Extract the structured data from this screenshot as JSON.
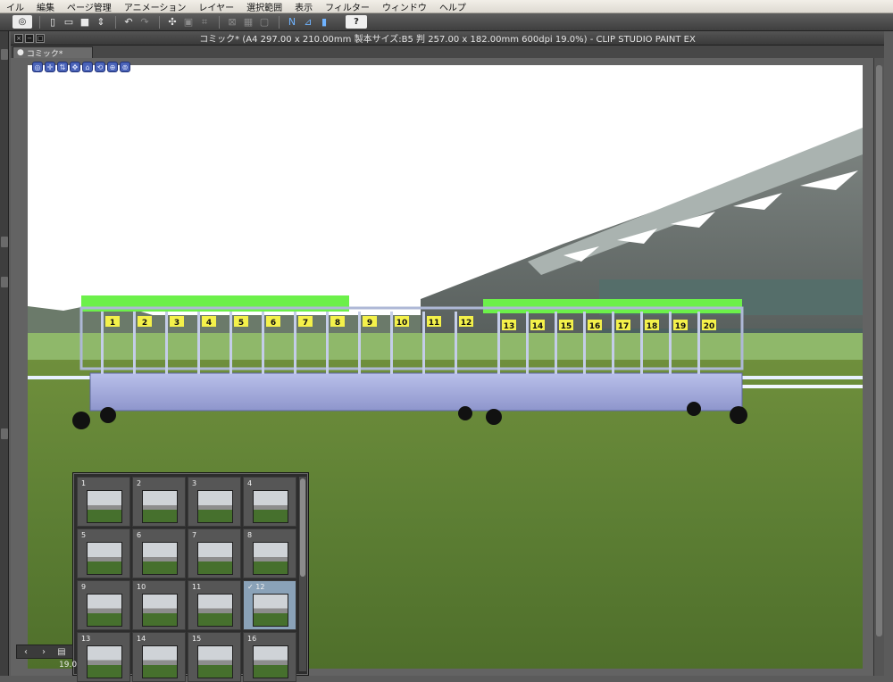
{
  "menubar": {
    "items": [
      "イル",
      "編集",
      "ページ管理",
      "アニメーション",
      "レイヤー",
      "選択範囲",
      "表示",
      "フィルター",
      "ウィンドウ",
      "ヘルプ"
    ]
  },
  "toolbar": {
    "icons": [
      "clip-logo-icon",
      "new-file-icon",
      "open-file-icon",
      "save-icon",
      "sort-icon",
      "undo-icon",
      "redo-icon",
      "transform-icon",
      "fit-icon",
      "crop-icon",
      "clear-icon",
      "fill-icon",
      "delete-icon",
      "snap-ruler-icon",
      "snap-grid-icon",
      "snap-point-icon",
      "help-icon"
    ],
    "help_label": "?"
  },
  "window": {
    "title": "コミック* (A4 297.00 x 210.00mm 製本サイズ:B5 判 257.00 x 182.00mm 600dpi 19.0%)  - CLIP STUDIO PAINT EX",
    "tab": "コミック*"
  },
  "gates": {
    "left": [
      "1",
      "2",
      "3",
      "4",
      "5",
      "6",
      "7",
      "8",
      "9",
      "10",
      "11",
      "12"
    ],
    "right": [
      "13",
      "14",
      "15",
      "16",
      "17",
      "18",
      "19",
      "20"
    ]
  },
  "pages": [
    {
      "num": "1"
    },
    {
      "num": "2"
    },
    {
      "num": "3"
    },
    {
      "num": "4"
    },
    {
      "num": "5"
    },
    {
      "num": "6"
    },
    {
      "num": "7"
    },
    {
      "num": "8"
    },
    {
      "num": "9"
    },
    {
      "num": "10"
    },
    {
      "num": "11"
    },
    {
      "num": "✓ 12",
      "selected": true
    },
    {
      "num": "13"
    },
    {
      "num": "14"
    },
    {
      "num": "15"
    },
    {
      "num": "16"
    }
  ],
  "status": {
    "zoom": "19.0"
  }
}
